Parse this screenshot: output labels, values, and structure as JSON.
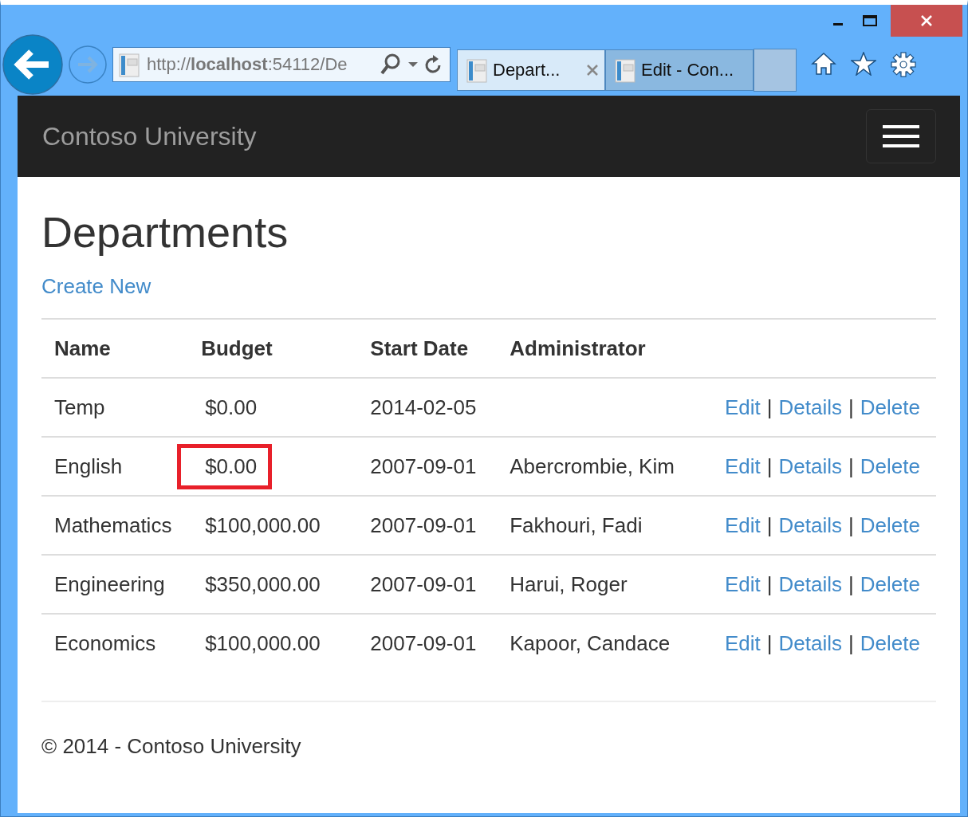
{
  "browser": {
    "address": "http://**localhost**:54112/De",
    "tabs": [
      {
        "title": "Depart...",
        "selected": true,
        "closable": true
      },
      {
        "title": "Edit - Con...",
        "selected": false,
        "closable": false
      }
    ]
  },
  "navbar": {
    "brand": "Contoso University"
  },
  "page": {
    "heading": "Departments",
    "create_link": "Create New"
  },
  "table": {
    "columns": [
      "Name",
      "Budget",
      "Start Date",
      "Administrator"
    ],
    "rows": [
      {
        "name": "Temp",
        "budget": "$0.00",
        "budget_highlighted": false,
        "start_date": "2014-02-05",
        "administrator": "",
        "actions": [
          "Edit",
          "Details",
          "Delete"
        ]
      },
      {
        "name": "English",
        "budget": "$0.00",
        "budget_highlighted": true,
        "start_date": "2007-09-01",
        "administrator": "Abercrombie, Kim",
        "actions": [
          "Edit",
          "Details",
          "Delete"
        ]
      },
      {
        "name": "Mathematics",
        "budget": "$100,000.00",
        "budget_highlighted": false,
        "start_date": "2007-09-01",
        "administrator": "Fakhouri, Fadi",
        "actions": [
          "Edit",
          "Details",
          "Delete"
        ]
      },
      {
        "name": "Engineering",
        "budget": "$350,000.00",
        "budget_highlighted": false,
        "start_date": "2007-09-01",
        "administrator": "Harui, Roger",
        "actions": [
          "Edit",
          "Details",
          "Delete"
        ]
      },
      {
        "name": "Economics",
        "budget": "$100,000.00",
        "budget_highlighted": false,
        "start_date": "2007-09-01",
        "administrator": "Kapoor, Candace",
        "actions": [
          "Edit",
          "Details",
          "Delete"
        ]
      }
    ],
    "separator": "|"
  },
  "footer": {
    "text": "© 2014 - Contoso University"
  }
}
